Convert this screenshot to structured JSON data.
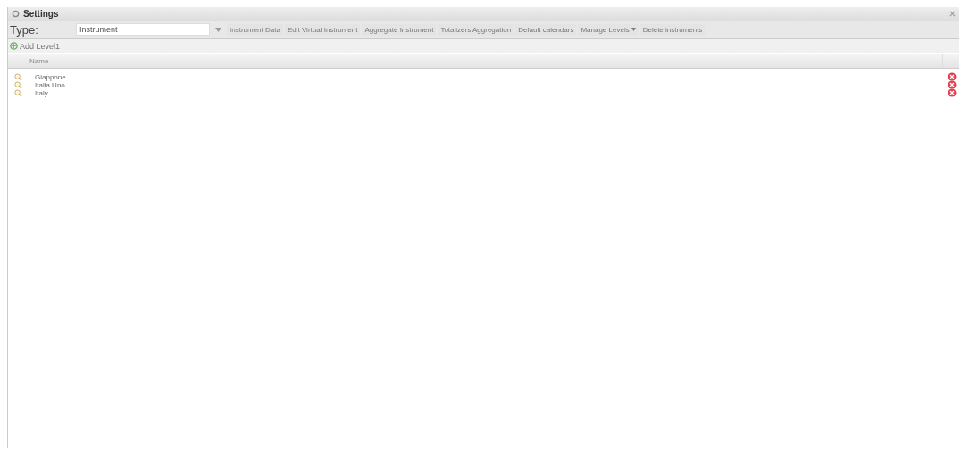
{
  "window": {
    "title": "Settings"
  },
  "toolbar": {
    "type_label": "Type:",
    "type_value": "Instrument",
    "buttons": [
      {
        "label": "Instrument Data",
        "kind": "button"
      },
      {
        "label": "Edit Virtual Instrument",
        "kind": "button"
      },
      {
        "label": "Aggregate Instrument",
        "kind": "button"
      },
      {
        "label": "Totalizers Aggregation",
        "kind": "button"
      },
      {
        "label": "Default calendars",
        "kind": "button"
      },
      {
        "label": "Manage Levels",
        "kind": "menu"
      },
      {
        "label": "Delete instruments",
        "kind": "button"
      }
    ]
  },
  "add_button": "Add Level1",
  "table": {
    "columns": [
      "Name"
    ],
    "rows": [
      {
        "name": "Giappone"
      },
      {
        "name": "Italia Uno"
      },
      {
        "name": "Italy"
      }
    ]
  }
}
